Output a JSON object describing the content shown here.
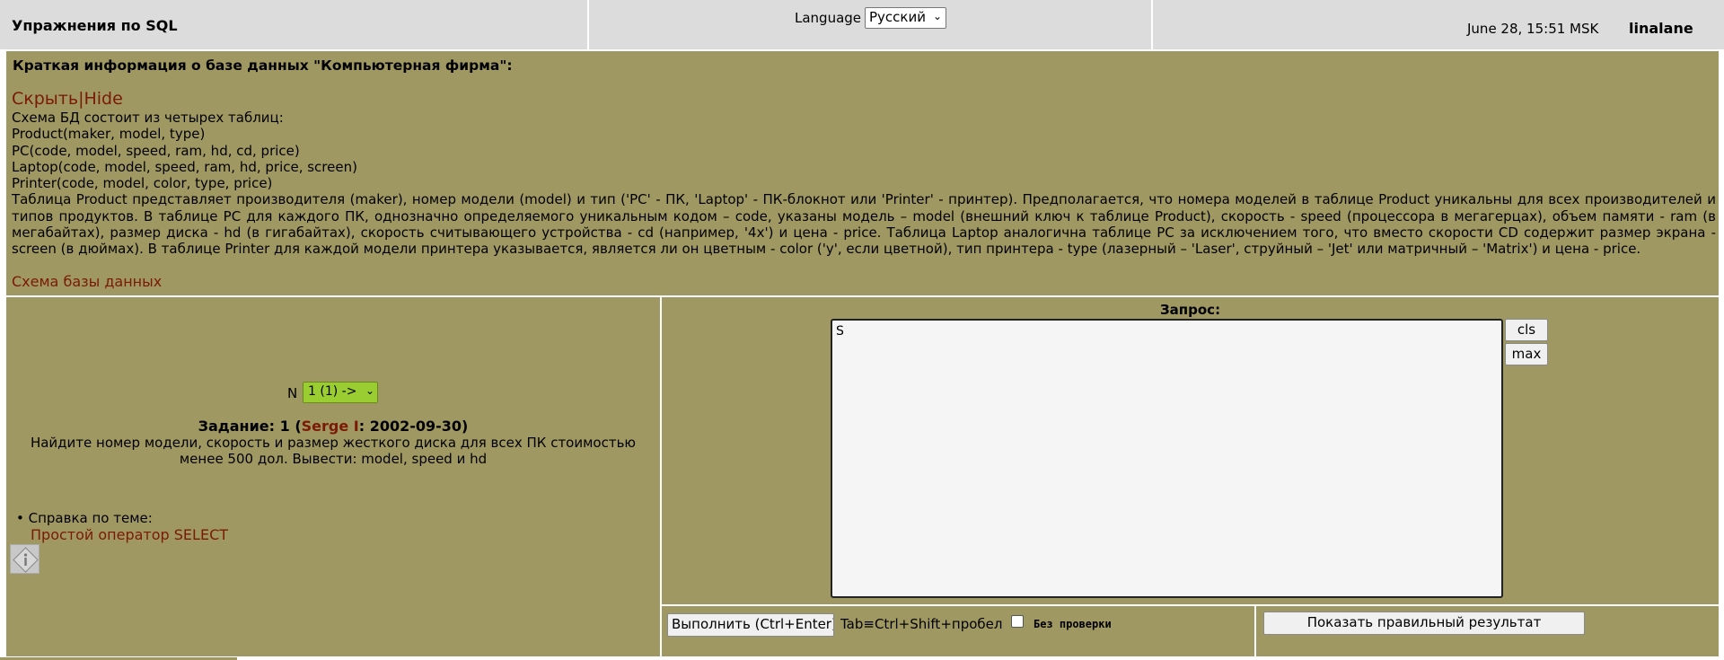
{
  "header": {
    "title": "Упражнения по SQL",
    "language_label": "Language",
    "language_selected": "Русский",
    "datetime": "June 28, 15:51 MSK",
    "username": "linalane"
  },
  "info": {
    "title": "Краткая информация о базе данных \"Компьютерная фирма\":",
    "toggle_link": "Скрыть|Hide",
    "lines": [
      "Схема БД состоит из четырех таблиц:",
      "Product(maker, model, type)",
      "PC(code, model, speed, ram, hd, cd, price)",
      "Laptop(code, model, speed, ram, hd, price, screen)",
      "Printer(code, model, color, type, price)"
    ],
    "description": "Таблица Product представляет производителя (maker), номер модели (model) и тип ('PC' - ПК, 'Laptop' - ПК-блокнот или 'Printer' - принтер). Предполагается, что номера моделей в таблице Product уникальны для всех производителей и типов продуктов. В таблице PC для каждого ПК, однозначно определяемого уникальным кодом – code, указаны модель – model (внешний ключ к таблице Product), скорость - speed (процессора в мегагерцах), объем памяти - ram (в мегабайтах), размер диска - hd (в гигабайтах), скорость считывающего устройства - cd (например, '4x') и цена - price. Таблица Laptop аналогична таблице PC за исключением того, что вместо скорости CD содержит размер экрана -screen (в дюймах). В таблице Printer для каждой модели принтера указывается, является ли он цветным - color ('y', если цветной), тип принтера - type (лазерный – 'Laser', струйный – 'Jet' или матричный – 'Matrix') и цена - price.",
    "schema_link": "Схема базы данных"
  },
  "task": {
    "n_label": "N",
    "n_selected": "1 (1) ->",
    "title_prefix": "Задание: 1 (",
    "author": "Serge I",
    "title_suffix": ": 2002-09-30)",
    "text": "Найдите номер модели, скорость и размер жесткого диска для всех ПК стоимостью менее 500 дол. Вывести: model, speed и hd",
    "help_label": "• Справка по теме:",
    "help_link": "Простой оператор SELECT"
  },
  "query": {
    "label": "Запрос:",
    "value": "S",
    "cls_label": "cls",
    "max_label": "max"
  },
  "actions": {
    "run_label": "Выполнить (Ctrl+Enter)",
    "tab_hint": "Tab≡Ctrl+Shift+пробел",
    "nocheck_label": "Без проверки",
    "show_result_label": "Показать правильный результат"
  }
}
